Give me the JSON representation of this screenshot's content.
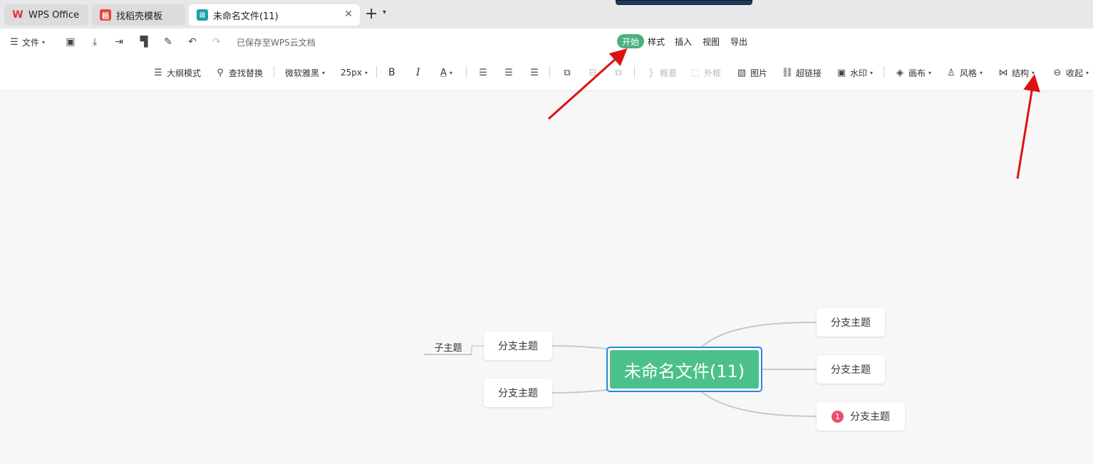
{
  "tabs": [
    {
      "label": "WPS Office",
      "icon": "wps-logo-icon"
    },
    {
      "label": "找稻壳模板",
      "icon": "docer-icon"
    },
    {
      "label": "未命名文件(11)",
      "icon": "mindmap-file-icon"
    }
  ],
  "menubar": {
    "file_label": "文件",
    "saved_status": "已保存至WPS云文档",
    "tabs": [
      "开始",
      "样式",
      "插入",
      "视图",
      "导出"
    ],
    "active_tab": "开始"
  },
  "toolbar": {
    "outline_mode": "大纲模式",
    "find_replace": "查找替换",
    "font_family": "微软雅黑",
    "font_size": "25px",
    "bold": "B",
    "italic": "I",
    "font_color": "A",
    "summary": "概要",
    "frame": "外框",
    "image": "图片",
    "hyperlink": "超链接",
    "watermark": "水印",
    "canvas": "画布",
    "style": "风格",
    "structure": "结构",
    "collapse": "收起"
  },
  "mindmap": {
    "root": "未命名文件(11)",
    "left_branches": [
      "分支主题",
      "分支主题"
    ],
    "left_subtopic": "子主题",
    "right_branches": [
      "分支主题",
      "分支主题",
      "分支主题"
    ],
    "right_branch3_badge": "1"
  },
  "colors": {
    "accent_green": "#4cc08a",
    "selection_blue": "#2b86e0",
    "arrow_red": "#dd1111",
    "badge_red": "#e8506c"
  }
}
